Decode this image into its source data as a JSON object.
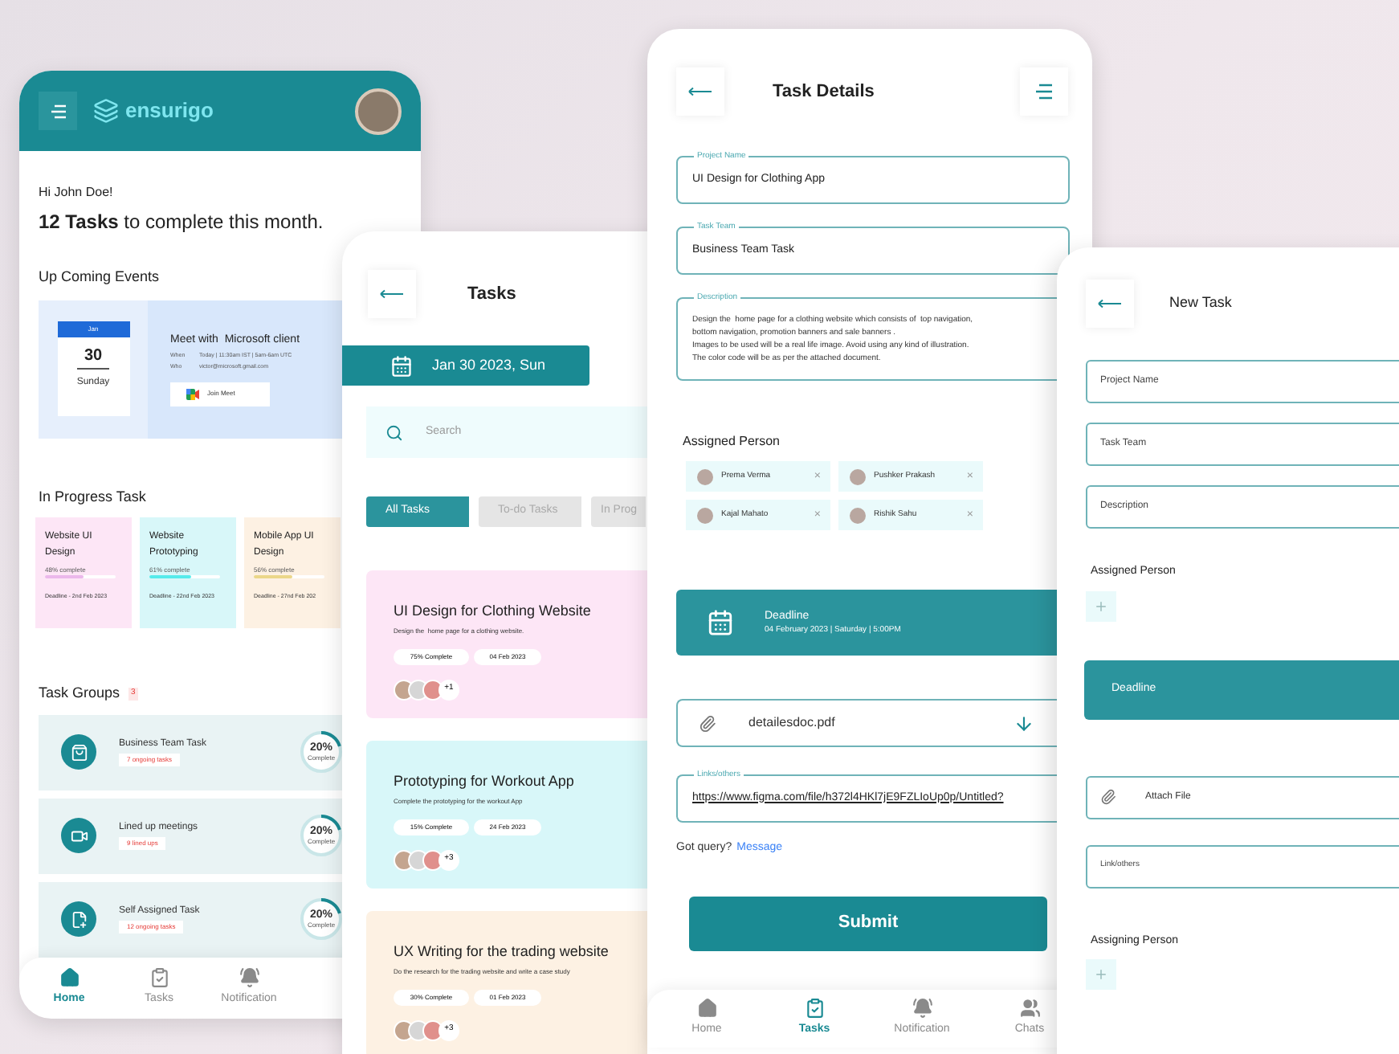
{
  "home": {
    "brand": "ensurigo",
    "greeting": "Hi John Doe!",
    "summary": "**12 Tasks** to complete this month.",
    "events_title": "Up Coming Events",
    "event": {
      "month": "Jan",
      "day": "30",
      "weekday": "Sunday",
      "title": "Meet with  Microsoft client",
      "when_label": "When",
      "when": "Today | 11:30am IST | 5am-6am UTC",
      "who_label": "Who",
      "who": "victor@microsoft.gmail.com",
      "join": "Join Meet"
    },
    "in_progress_title": "In Progress Task",
    "in_progress": [
      {
        "title": "Website UI Design",
        "progress_label": "48% complete",
        "level": 0.55,
        "deadline": "Deadline - 2nd Feb 2023",
        "color": "#fde6f6"
      },
      {
        "title": "Website Prototyping",
        "progress_label": "61% complete",
        "level": 0.6,
        "deadline": "Deadline - 22nd Feb 2023",
        "color": "#d8f7f9"
      },
      {
        "title": "Mobile App UI Design",
        "progress_label": "56% complete",
        "level": 0.55,
        "deadline": "Deadline - 27nd Feb 202",
        "color": "#fdf1e3"
      }
    ],
    "groups_title": "Task Groups",
    "groups_count": "3",
    "groups": [
      {
        "kind": "bag",
        "title": "Business Team Task",
        "subtitle": "7 ongoing tasks",
        "percent": "20%",
        "percent_label": "Complete",
        "level": 0.2
      },
      {
        "kind": "video",
        "title": "Lined up meetings",
        "subtitle": "9 lined ups",
        "percent": "20%",
        "percent_label": "Complete",
        "level": 0.2
      },
      {
        "kind": "file",
        "title": "Self Assigned Task",
        "subtitle": "12 ongoing tasks",
        "percent": "20%",
        "percent_label": "Complete",
        "level": 0.2
      }
    ],
    "nav": [
      {
        "kind": "home",
        "label": "Home",
        "selected": true
      },
      {
        "kind": "tasks",
        "label": "Tasks",
        "selected": false
      },
      {
        "kind": "bell",
        "label": "Notification",
        "selected": false
      }
    ]
  },
  "tasks": {
    "title": "Tasks",
    "date": "Jan 30 2023, Sun",
    "search_placeholder": "Search",
    "filters": [
      {
        "label": "All Tasks",
        "selected": true
      },
      {
        "label": "To-do Tasks",
        "selected": false
      },
      {
        "label": "In Prog",
        "selected": false
      }
    ],
    "cards": [
      {
        "title": "UI Design for Clothing Website",
        "subtitle": "Design the  home page for a clothing website.",
        "progress": "75% Complete",
        "date": "04 Feb 2023",
        "extra": "+1",
        "color": "#fde6f6"
      },
      {
        "title": "Prototyping for Workout App",
        "subtitle": "Complete the prototyping for the workout App",
        "progress": "15% Complete",
        "date": "24 Feb 2023",
        "extra": "+3",
        "color": "#d8f7f9"
      },
      {
        "title": "UX Writing for the trading website",
        "subtitle": "Do the research for the trading website and write a case study",
        "progress": "30% Complete",
        "date": "01 Feb 2023",
        "extra": "+3",
        "color": "#fdf1e3"
      }
    ]
  },
  "details": {
    "title": "Task Details",
    "fields": [
      {
        "label": "Project Name",
        "value": "UI Design for Clothing App"
      },
      {
        "label": "Task Team",
        "value": "Business Team Task"
      }
    ],
    "description": {
      "label": "Description",
      "lines": [
        "Design the  home page for a clothing website which consists of  top navigation,",
        "bottom navigation, promotion banners and sale banners .",
        "Images to be used will be a real life image. Avoid using any kind of illustration.",
        "The color code will be as per the attached document."
      ]
    },
    "assigned_title": "Assigned Person",
    "assigned": [
      {
        "name": "Prema Verma",
        "remove": "×"
      },
      {
        "name": "Pushker Prakash",
        "remove": "×"
      },
      {
        "name": "Kajal Mahato",
        "remove": "×"
      },
      {
        "name": "Rishik Sahu",
        "remove": "×"
      }
    ],
    "deadline": {
      "label": "Deadline",
      "value": "04 February 2023 | Saturday | 5:00PM"
    },
    "attachment": "detailesdoc.pdf",
    "links": {
      "label": "Links/others",
      "value": "https://www.figma.com/file/h372l4HKl7jE9FZLIoUp0p/Untitled?"
    },
    "query": "Got query?",
    "query_link": "Message",
    "submit": "Submit",
    "nav": [
      {
        "kind": "home",
        "label": "Home",
        "selected": false
      },
      {
        "kind": "tasks",
        "label": "Tasks",
        "selected": true
      },
      {
        "kind": "bell",
        "label": "Notification",
        "selected": false
      },
      {
        "kind": "chats",
        "label": "Chats",
        "selected": false
      }
    ]
  },
  "new_task": {
    "title": "New Task",
    "fields": [
      "Project Name",
      "Task Team",
      "Description"
    ],
    "assigned_title": "Assigned Person",
    "deadline": "Deadline",
    "attach": "Attach File",
    "link": "Link/others",
    "assigning_title": "Assigning Person"
  }
}
